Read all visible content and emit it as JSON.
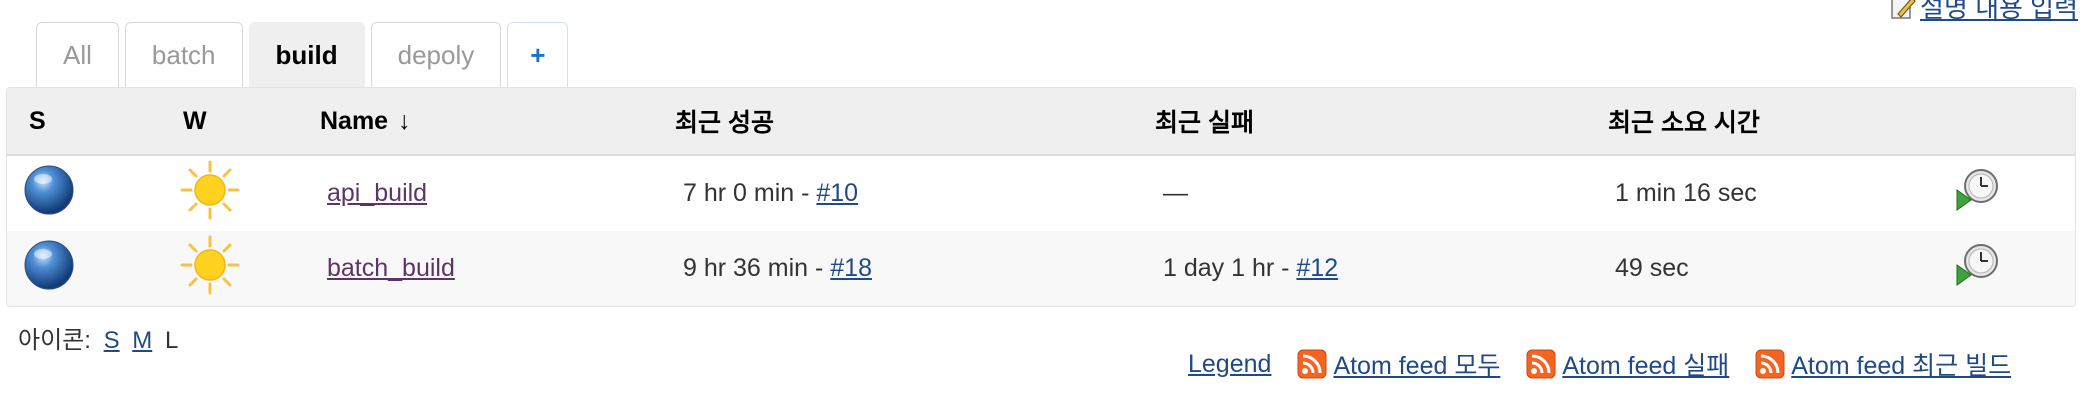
{
  "description_link": "설명 내용 입력",
  "tabs": [
    {
      "label": "All",
      "active": false
    },
    {
      "label": "batch",
      "active": false
    },
    {
      "label": "build",
      "active": true
    },
    {
      "label": "depoly",
      "active": false
    },
    {
      "label": "+",
      "active": false
    }
  ],
  "table": {
    "headers": {
      "s": "S",
      "w": "W",
      "name": "Name",
      "sort_arrow": "↓",
      "last_success": "최근 성공",
      "last_failure": "최근 실패",
      "last_duration": "최근 소요 시간"
    },
    "rows": [
      {
        "status": "blue-ball-icon",
        "weather": "sunny-icon",
        "name": "api_build",
        "success_time": "7 hr 0 min - ",
        "success_build": "#10",
        "failure_text": "—",
        "failure_build": "",
        "duration": "1 min 16 sec"
      },
      {
        "status": "blue-ball-icon",
        "weather": "sunny-icon",
        "name": "batch_build",
        "success_time": "9 hr 36 min - ",
        "success_build": "#18",
        "failure_text": "1 day 1 hr - ",
        "failure_build": "#12",
        "duration": "49 sec"
      }
    ]
  },
  "icon_size": {
    "label": "아이콘:",
    "s": "S",
    "m": "M",
    "l": "L"
  },
  "footer": {
    "legend": "Legend",
    "feed_all": "Atom feed 모두",
    "feed_failures": "Atom feed 실패",
    "feed_latest": "Atom feed 최근 빌드"
  },
  "colors": {
    "link": "#204a87",
    "visited_link": "#5c3566",
    "header_bg": "#efefef",
    "rss_orange": "#f26522"
  }
}
